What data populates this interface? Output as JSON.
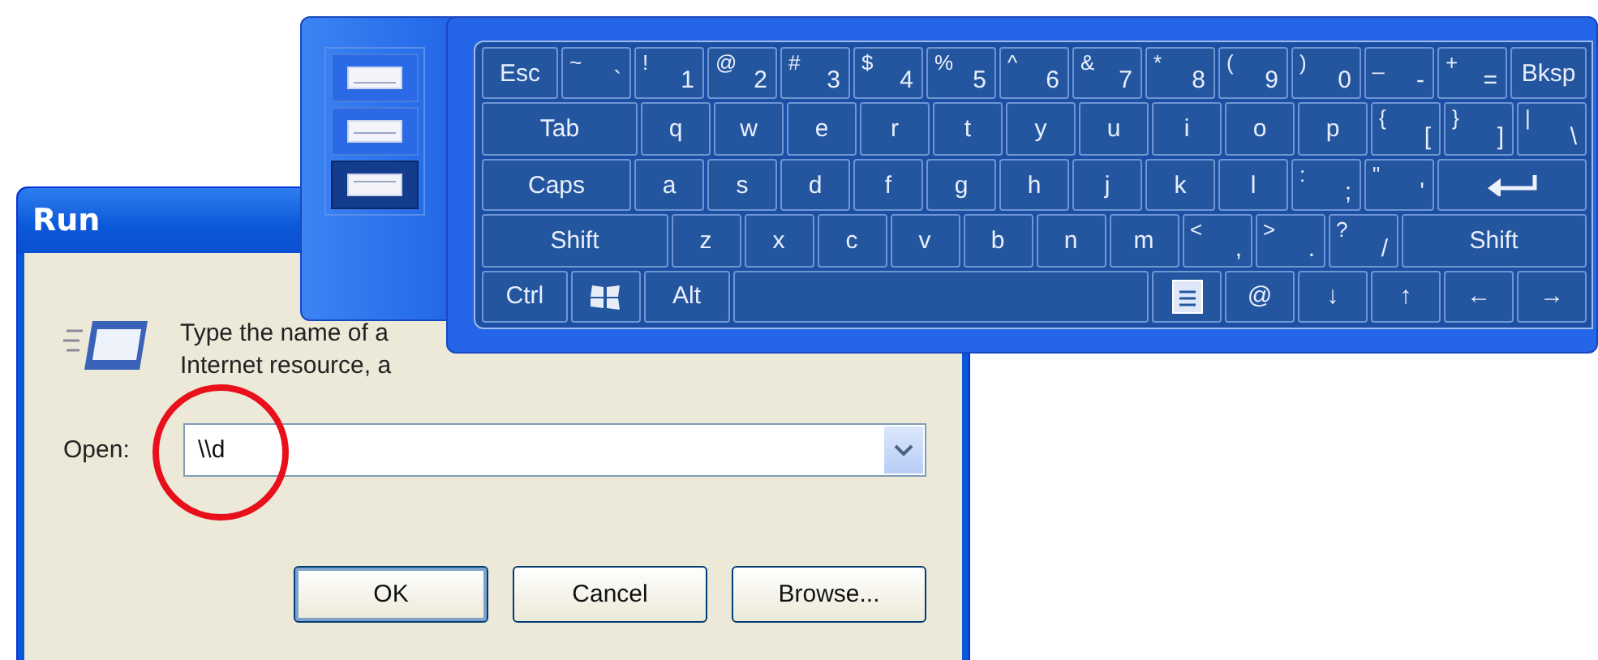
{
  "input_panel": {
    "modes": [
      {
        "selected": false
      },
      {
        "selected": false
      },
      {
        "selected": true
      }
    ],
    "keyboard": {
      "key_rows": [
        [
          {
            "kind": "text",
            "label": "Esc"
          },
          {
            "kind": "char",
            "shift": "~",
            "label": "`"
          },
          {
            "kind": "char",
            "shift": "!",
            "label": "1"
          },
          {
            "kind": "char",
            "shift": "@",
            "label": "2"
          },
          {
            "kind": "char",
            "shift": "#",
            "label": "3"
          },
          {
            "kind": "char",
            "shift": "$",
            "label": "4"
          },
          {
            "kind": "char",
            "shift": "%",
            "label": "5"
          },
          {
            "kind": "char",
            "shift": "^",
            "label": "6"
          },
          {
            "kind": "char",
            "shift": "&",
            "label": "7"
          },
          {
            "kind": "char",
            "shift": "*",
            "label": "8"
          },
          {
            "kind": "char",
            "shift": "(",
            "label": "9"
          },
          {
            "kind": "char",
            "shift": ")",
            "label": "0"
          },
          {
            "kind": "char",
            "shift": "_",
            "label": "-"
          },
          {
            "kind": "char",
            "shift": "+",
            "label": "="
          },
          {
            "kind": "text",
            "label": "Bksp"
          }
        ],
        [
          {
            "kind": "text",
            "label": "Tab"
          },
          {
            "kind": "char",
            "label": "q"
          },
          {
            "kind": "char",
            "label": "w"
          },
          {
            "kind": "char",
            "label": "e"
          },
          {
            "kind": "char",
            "label": "r"
          },
          {
            "kind": "char",
            "label": "t"
          },
          {
            "kind": "char",
            "label": "y"
          },
          {
            "kind": "char",
            "label": "u"
          },
          {
            "kind": "char",
            "label": "i"
          },
          {
            "kind": "char",
            "label": "o"
          },
          {
            "kind": "char",
            "label": "p"
          },
          {
            "kind": "char",
            "shift": "{",
            "label": "["
          },
          {
            "kind": "char",
            "shift": "}",
            "label": "]"
          },
          {
            "kind": "char",
            "shift": "|",
            "label": "\\"
          }
        ],
        [
          {
            "kind": "text",
            "label": "Caps"
          },
          {
            "kind": "char",
            "label": "a"
          },
          {
            "kind": "char",
            "label": "s"
          },
          {
            "kind": "char",
            "label": "d"
          },
          {
            "kind": "char",
            "label": "f"
          },
          {
            "kind": "char",
            "label": "g"
          },
          {
            "kind": "char",
            "label": "h"
          },
          {
            "kind": "char",
            "label": "j"
          },
          {
            "kind": "char",
            "label": "k"
          },
          {
            "kind": "char",
            "label": "l"
          },
          {
            "kind": "char",
            "shift": ":",
            "label": ";"
          },
          {
            "kind": "char",
            "shift": "\"",
            "label": "'"
          },
          {
            "kind": "enter"
          }
        ],
        [
          {
            "kind": "text",
            "label": "Shift"
          },
          {
            "kind": "char",
            "label": "z"
          },
          {
            "kind": "char",
            "label": "x"
          },
          {
            "kind": "char",
            "label": "c"
          },
          {
            "kind": "char",
            "label": "v"
          },
          {
            "kind": "char",
            "label": "b"
          },
          {
            "kind": "char",
            "label": "n"
          },
          {
            "kind": "char",
            "label": "m"
          },
          {
            "kind": "char",
            "shift": "<",
            "label": ","
          },
          {
            "kind": "char",
            "shift": ">",
            "label": "."
          },
          {
            "kind": "char",
            "shift": "?",
            "label": "/"
          },
          {
            "kind": "text",
            "label": "Shift"
          }
        ],
        [
          {
            "kind": "text",
            "label": "Ctrl"
          },
          {
            "kind": "windows"
          },
          {
            "kind": "text",
            "label": "Alt"
          },
          {
            "kind": "space"
          },
          {
            "kind": "menu"
          },
          {
            "kind": "char",
            "label": "@"
          },
          {
            "kind": "char",
            "label": "↓"
          },
          {
            "kind": "char",
            "label": "↑"
          },
          {
            "kind": "char",
            "label": "←"
          },
          {
            "kind": "char",
            "label": "→"
          }
        ]
      ]
    }
  },
  "dialog": {
    "title": "Run",
    "description": "Type the name of a\nInternet resource, a",
    "open_label": "Open:",
    "open_value": "\\\\d",
    "buttons": [
      {
        "label": "OK",
        "default": true
      },
      {
        "label": "Cancel",
        "default": false
      },
      {
        "label": "Browse...",
        "default": false
      }
    ]
  }
}
